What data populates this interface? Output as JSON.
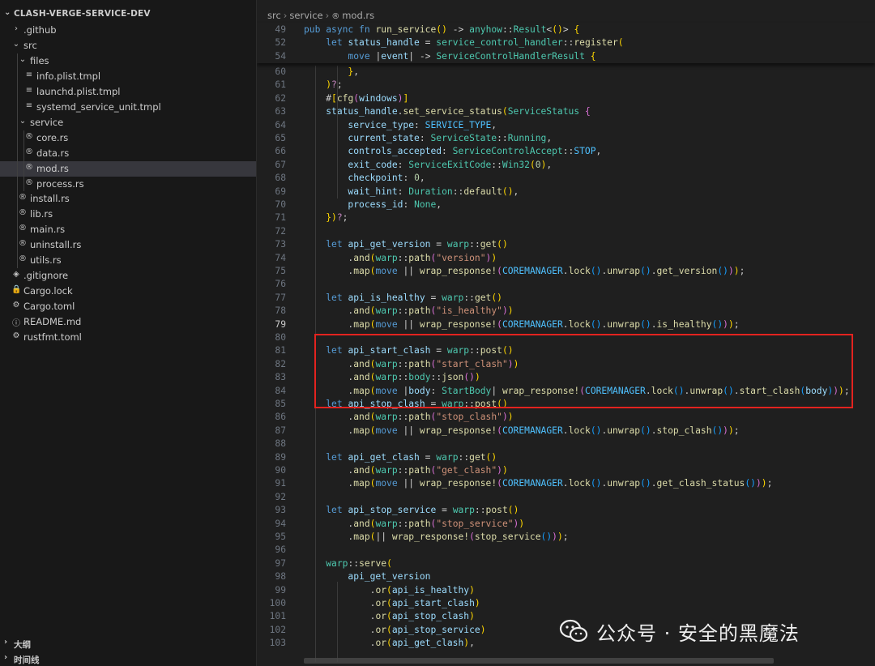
{
  "explorer": {
    "title": "CLASH-VERGE-SERVICE-DEV",
    "items": [
      {
        "label": ".github",
        "kind": "folder",
        "expanded": false
      },
      {
        "label": "src",
        "kind": "folder",
        "expanded": true
      },
      {
        "label": "files",
        "kind": "folder",
        "expanded": true
      },
      {
        "label": "info.plist.tmpl",
        "kind": "file"
      },
      {
        "label": "launchd.plist.tmpl",
        "kind": "file"
      },
      {
        "label": "systemd_service_unit.tmpl",
        "kind": "file"
      },
      {
        "label": "service",
        "kind": "folder",
        "expanded": true
      },
      {
        "label": "core.rs",
        "kind": "rust"
      },
      {
        "label": "data.rs",
        "kind": "rust"
      },
      {
        "label": "mod.rs",
        "kind": "rust",
        "selected": true
      },
      {
        "label": "process.rs",
        "kind": "rust"
      },
      {
        "label": "install.rs",
        "kind": "rust"
      },
      {
        "label": "lib.rs",
        "kind": "rust"
      },
      {
        "label": "main.rs",
        "kind": "rust"
      },
      {
        "label": "uninstall.rs",
        "kind": "rust"
      },
      {
        "label": "utils.rs",
        "kind": "rust"
      },
      {
        "label": ".gitignore",
        "kind": "git"
      },
      {
        "label": "Cargo.lock",
        "kind": "lock"
      },
      {
        "label": "Cargo.toml",
        "kind": "gear"
      },
      {
        "label": "README.md",
        "kind": "info"
      },
      {
        "label": "rustfmt.toml",
        "kind": "gear"
      }
    ],
    "panels": [
      {
        "label": "大纲"
      },
      {
        "label": "时间线"
      }
    ]
  },
  "breadcrumb": {
    "parts": [
      "src",
      "service",
      "mod.rs"
    ]
  },
  "editor": {
    "current_line": "79",
    "lines": [
      {
        "n": "49",
        "code": "pub async fn run_service() -> anyhow::Result<()> {"
      },
      {
        "n": "52",
        "code": "    let status_handle = service_control_handler::register("
      },
      {
        "n": "54",
        "code": "        move |event| -> ServiceControlHandlerResult {"
      },
      {
        "n": "60",
        "code": "        },"
      },
      {
        "n": "61",
        "code": "    )?;"
      },
      {
        "n": "62",
        "code": "    #[cfg(windows)]"
      },
      {
        "n": "63",
        "code": "    status_handle.set_service_status(ServiceStatus {"
      },
      {
        "n": "64",
        "code": "        service_type: SERVICE_TYPE,"
      },
      {
        "n": "65",
        "code": "        current_state: ServiceState::Running,"
      },
      {
        "n": "66",
        "code": "        controls_accepted: ServiceControlAccept::STOP,"
      },
      {
        "n": "67",
        "code": "        exit_code: ServiceExitCode::Win32(0),"
      },
      {
        "n": "68",
        "code": "        checkpoint: 0,"
      },
      {
        "n": "69",
        "code": "        wait_hint: Duration::default(),"
      },
      {
        "n": "70",
        "code": "        process_id: None,"
      },
      {
        "n": "71",
        "code": "    })?;"
      },
      {
        "n": "72",
        "code": ""
      },
      {
        "n": "73",
        "code": "    let api_get_version = warp::get()"
      },
      {
        "n": "74",
        "code": "        .and(warp::path(\"version\"))"
      },
      {
        "n": "75",
        "code": "        .map(move || wrap_response!(COREMANAGER.lock().unwrap().get_version()));"
      },
      {
        "n": "76",
        "code": ""
      },
      {
        "n": "77",
        "code": "    let api_is_healthy = warp::get()"
      },
      {
        "n": "78",
        "code": "        .and(warp::path(\"is_healthy\"))"
      },
      {
        "n": "79",
        "code": "        .map(move || wrap_response!(COREMANAGER.lock().unwrap().is_healthy()));"
      },
      {
        "n": "80",
        "code": ""
      },
      {
        "n": "81",
        "code": "    let api_start_clash = warp::post()"
      },
      {
        "n": "82",
        "code": "        .and(warp::path(\"start_clash\"))"
      },
      {
        "n": "83",
        "code": "        .and(warp::body::json())"
      },
      {
        "n": "84",
        "code": "        .map(move |body: StartBody| wrap_response!(COREMANAGER.lock().unwrap().start_clash(body)));"
      },
      {
        "n": "85",
        "code": "    let api_stop_clash = warp::post()"
      },
      {
        "n": "86",
        "code": "        .and(warp::path(\"stop_clash\"))"
      },
      {
        "n": "87",
        "code": "        .map(move || wrap_response!(COREMANAGER.lock().unwrap().stop_clash()));"
      },
      {
        "n": "88",
        "code": ""
      },
      {
        "n": "89",
        "code": "    let api_get_clash = warp::get()"
      },
      {
        "n": "90",
        "code": "        .and(warp::path(\"get_clash\"))"
      },
      {
        "n": "91",
        "code": "        .map(move || wrap_response!(COREMANAGER.lock().unwrap().get_clash_status()));"
      },
      {
        "n": "92",
        "code": ""
      },
      {
        "n": "93",
        "code": "    let api_stop_service = warp::post()"
      },
      {
        "n": "94",
        "code": "        .and(warp::path(\"stop_service\"))"
      },
      {
        "n": "95",
        "code": "        .map(|| wrap_response!(stop_service()));"
      },
      {
        "n": "96",
        "code": ""
      },
      {
        "n": "97",
        "code": "    warp::serve("
      },
      {
        "n": "98",
        "code": "        api_get_version"
      },
      {
        "n": "99",
        "code": "            .or(api_is_healthy)"
      },
      {
        "n": "100",
        "code": "            .or(api_start_clash)"
      },
      {
        "n": "101",
        "code": "            .or(api_stop_clash)"
      },
      {
        "n": "102",
        "code": "            .or(api_stop_service)"
      },
      {
        "n": "103",
        "code": "            .or(api_get_clash),"
      }
    ]
  },
  "watermark": {
    "text": "公众号 · 安全的黑魔法"
  },
  "colors": {
    "highlight_box": "#e3231f",
    "sidebar_bg": "#181818",
    "editor_bg": "#1f1f1f"
  }
}
